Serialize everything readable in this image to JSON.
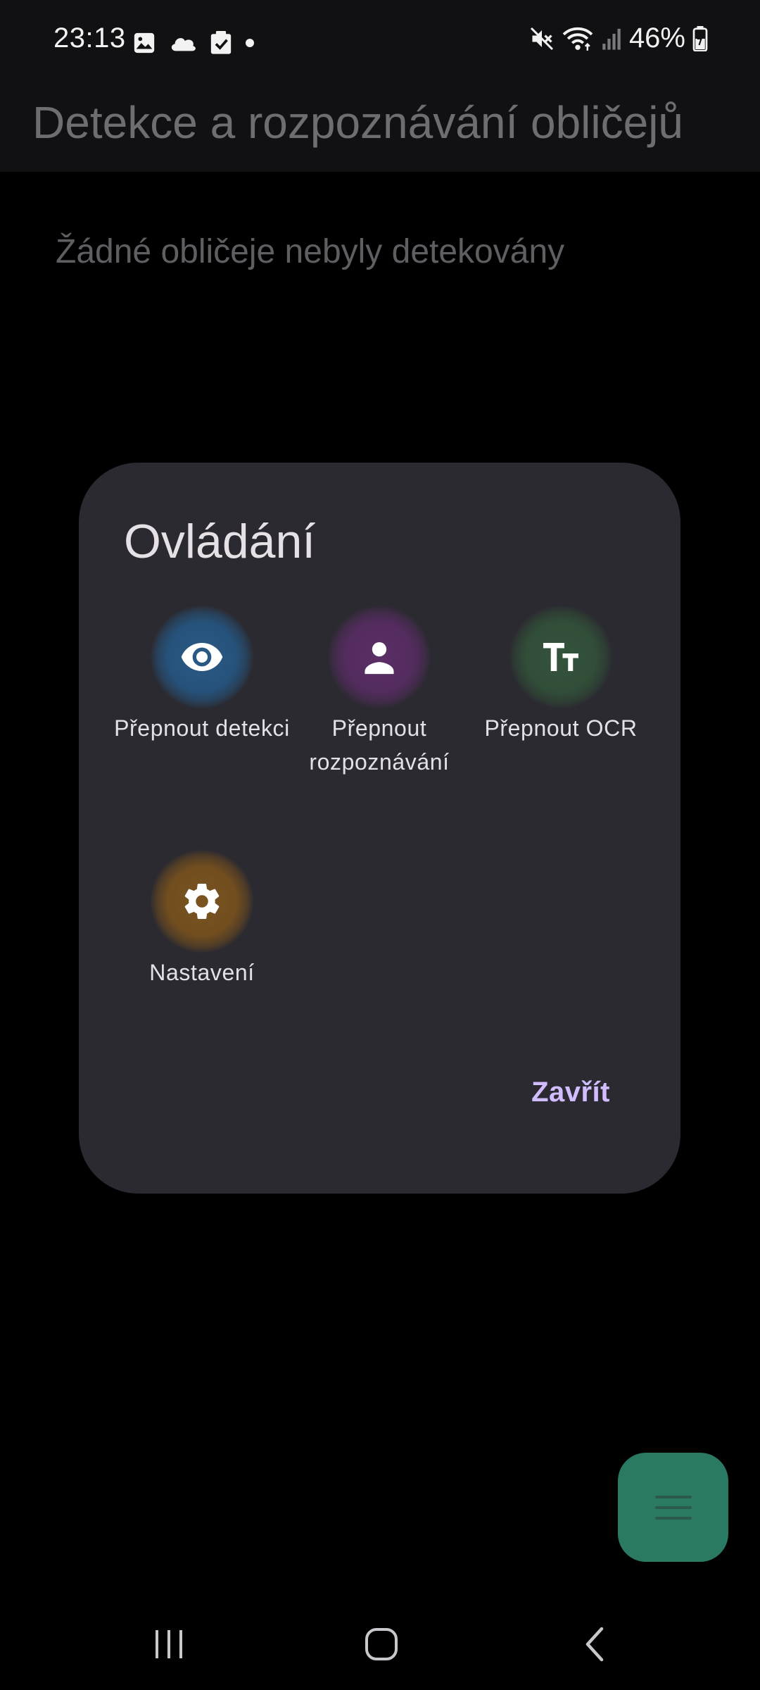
{
  "status_bar": {
    "time": "23:13",
    "battery": "46%",
    "left_icons": [
      "gallery-icon",
      "cloud-icon",
      "checkbox-icon",
      "dot-icon"
    ],
    "right_icons": [
      "mute-icon",
      "wifi-icon",
      "signal-icon",
      "battery-icon"
    ]
  },
  "app_bar": {
    "title": "Detekce a rozpoznávání obličejů"
  },
  "main": {
    "empty_message": "Žádné obličeje nebyly detekovány"
  },
  "dialog": {
    "title": "Ovládání",
    "actions": [
      {
        "label": "Přepnout detekci",
        "icon": "eye-icon",
        "color": "#26527a"
      },
      {
        "label": "Přepnout rozpoznávání",
        "icon": "person-icon",
        "color": "#532c5e"
      },
      {
        "label": "Přepnout OCR",
        "icon": "text-fields-icon",
        "color": "#314e38"
      },
      {
        "label": "Nastavení",
        "icon": "gear-icon",
        "color": "#714d1f"
      }
    ],
    "close_label": "Zavřít"
  },
  "fab": {
    "icon": "menu-icon",
    "color": "#2a7a63"
  },
  "nav_bar": {
    "buttons": [
      "recents-icon",
      "home-icon",
      "back-icon"
    ]
  },
  "colors": {
    "background": "#000000",
    "dialog_surface": "#2b2a30",
    "accent": "#d0bcff"
  }
}
